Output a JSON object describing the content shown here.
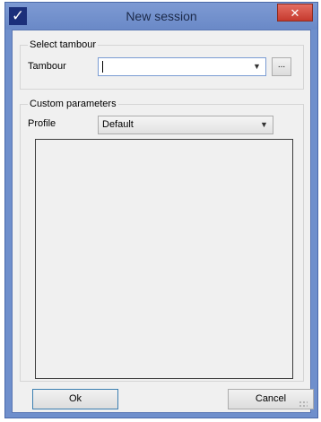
{
  "window": {
    "title": "New session",
    "icon": "check-mark-icon",
    "close_glyph": "✕"
  },
  "tambour_group": {
    "label": "Select tambour",
    "field_label": "Tambour",
    "value": "",
    "browse_label": "..."
  },
  "params_group": {
    "label": "Custom parameters",
    "profile_label": "Profile",
    "profile_value": "Default"
  },
  "buttons": {
    "ok": "Ok",
    "cancel": "Cancel"
  },
  "colors": {
    "titlebar": "#6f8fcc",
    "close_button": "#c63a2e",
    "client_bg": "#f0f0f0"
  }
}
